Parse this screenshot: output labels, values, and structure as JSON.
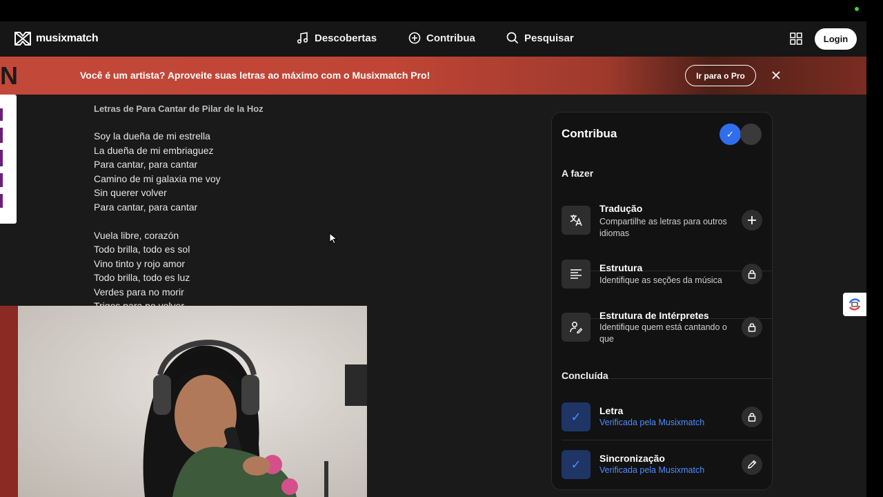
{
  "header": {
    "brand": "musixmatch",
    "nav": [
      {
        "label": "Descobertas",
        "icon": "music-note-icon"
      },
      {
        "label": "Contribua",
        "icon": "plus-circle-icon"
      },
      {
        "label": "Pesquisar",
        "icon": "search-icon"
      }
    ],
    "login_label": "Login"
  },
  "banner": {
    "text": "Você é um artista? Aproveite suas letras ao máximo com o Musixmatch Pro!",
    "button_label": "Ir para o Pro",
    "side_letter": "N"
  },
  "lyrics": {
    "title": "Letras de Para Cantar de Pilar de la Hoz",
    "stanzas": [
      [
        "Soy la dueña de mi estrella",
        "La dueña de mi embriaguez",
        "Para cantar, para cantar",
        "Camino de mi galaxia me voy",
        "Sin querer volver",
        "Para cantar, para cantar"
      ],
      [
        "Vuela libre, corazón",
        "Todo brilla, todo es sol",
        "Vino tinto y rojo amor",
        "Todo brilla, todo es luz",
        "Verdes para no morir",
        "Trigos para no volver"
      ]
    ]
  },
  "contribute": {
    "title": "Contribua",
    "todo_heading": "A fazer",
    "done_heading": "Concluída",
    "toggle_check": "✓",
    "todo": [
      {
        "name": "Tradução",
        "desc": "Compartilhe as letras para outros idiomas",
        "icon": "translate-icon",
        "action": "plus-icon"
      },
      {
        "name": "Estrutura",
        "desc": "Identifique as seções da música",
        "icon": "align-left-icon",
        "action": "lock-icon"
      },
      {
        "name": "Estrutura de Intérpretes",
        "desc": "Identifique quem está cantando o que",
        "icon": "person-edit-icon",
        "action": "lock-icon"
      }
    ],
    "done": [
      {
        "name": "Letra",
        "desc": "Verificada pela Musixmatch",
        "icon": "check-icon",
        "check": "✓",
        "action": "lock-icon"
      },
      {
        "name": "Sincronização",
        "desc": "Verificada pela Musixmatch",
        "icon": "check-icon",
        "check": "✓",
        "action": "pencil-icon"
      }
    ]
  },
  "colors": {
    "accent_blue": "#2f6fed",
    "verified_blue": "#4e8cff",
    "banner_red": "#c2483a"
  }
}
